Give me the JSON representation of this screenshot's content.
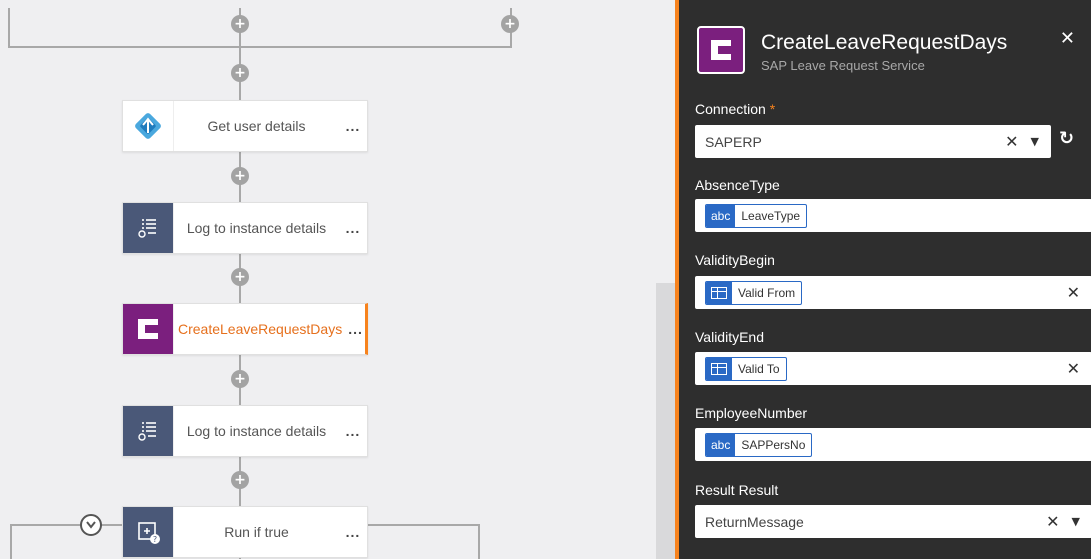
{
  "workflow": {
    "steps": [
      {
        "label": "Get user details",
        "icon": "user-lookup-icon"
      },
      {
        "label": "Log to instance details",
        "icon": "log-icon"
      },
      {
        "label": "CreateLeaveRequestDays",
        "icon": "sap-connector-icon",
        "selected": true
      },
      {
        "label": "Log to instance details",
        "icon": "log-icon"
      },
      {
        "label": "Run if true",
        "icon": "run-if-icon"
      }
    ],
    "more_label": "...",
    "add_glyph": "+",
    "collapse_glyph": "v"
  },
  "panel": {
    "title": "CreateLeaveRequestDays",
    "subtitle": "SAP Leave Request Service",
    "close_glyph": "✕",
    "fields": {
      "connection": {
        "label": "Connection",
        "required_marker": "*",
        "value": "SAPERP"
      },
      "absence_type": {
        "label": "AbsenceType",
        "tag_type": "abc",
        "tag_value": "LeaveType"
      },
      "validity_begin": {
        "label": "ValidityBegin",
        "tag_value": "Valid From"
      },
      "validity_end": {
        "label": "ValidityEnd",
        "tag_value": "Valid To"
      },
      "employee_number": {
        "label": "EmployeeNumber",
        "tag_type": "abc",
        "tag_value": "SAPPersNo"
      },
      "result": {
        "label": "Result Result",
        "value": "ReturnMessage"
      }
    },
    "clear_glyph": "✕",
    "dropdown_glyph": "▼",
    "refresh_glyph": "↻"
  },
  "colors": {
    "accent": "#f7831e",
    "sap_purple": "#7b1f7e",
    "tag_blue": "#2a69c5",
    "panel_bg": "#2e2e2e"
  }
}
